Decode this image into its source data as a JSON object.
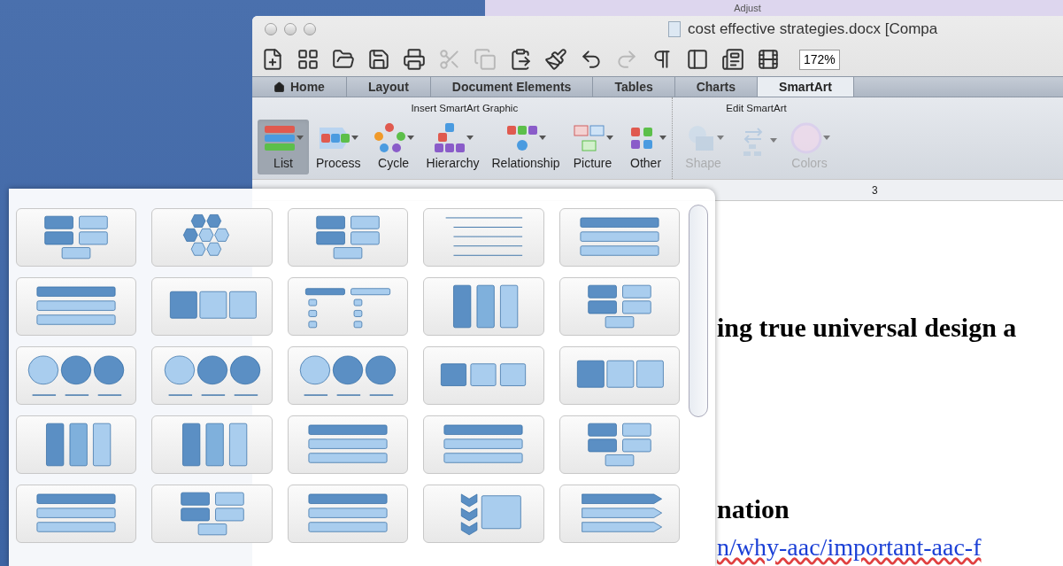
{
  "background_window": {
    "title": "Adjust"
  },
  "window": {
    "title": "cost effective strategies.docx [Compa"
  },
  "toolbar": {
    "zoom": "172%"
  },
  "tabs": [
    {
      "label": "Home",
      "kind": "home",
      "selected": false
    },
    {
      "label": "Layout",
      "kind": "plain",
      "selected": false
    },
    {
      "label": "Document Elements",
      "kind": "plain",
      "selected": false
    },
    {
      "label": "Tables",
      "kind": "plain",
      "selected": false
    },
    {
      "label": "Charts",
      "kind": "plain",
      "selected": false
    },
    {
      "label": "SmartArt",
      "kind": "plain",
      "selected": true
    }
  ],
  "ribbon": {
    "groups": [
      {
        "title": "Insert SmartArt Graphic",
        "buttons": [
          {
            "label": "List",
            "kind": "list",
            "selected": true,
            "disabled": false
          },
          {
            "label": "Process",
            "kind": "process",
            "selected": false,
            "disabled": false
          },
          {
            "label": "Cycle",
            "kind": "cycle",
            "selected": false,
            "disabled": false
          },
          {
            "label": "Hierarchy",
            "kind": "hierarchy",
            "selected": false,
            "disabled": false
          },
          {
            "label": "Relationship",
            "kind": "relationship",
            "selected": false,
            "disabled": false
          },
          {
            "label": "Picture",
            "kind": "picture",
            "selected": false,
            "disabled": false
          },
          {
            "label": "Other",
            "kind": "other",
            "selected": false,
            "disabled": false
          }
        ]
      },
      {
        "title": "Edit SmartArt",
        "buttons": [
          {
            "label": "Shape",
            "kind": "shape",
            "selected": false,
            "disabled": true
          },
          {
            "kind": "arrange",
            "selected": false,
            "disabled": true
          },
          {
            "label": "Colors",
            "kind": "colors",
            "selected": false,
            "disabled": true
          }
        ]
      }
    ]
  },
  "ruler": {
    "marker": "3"
  },
  "document": {
    "lines": [
      {
        "kind": "heading",
        "text": "ing true universal design a"
      },
      {
        "kind": "heading",
        "text": "nation"
      },
      {
        "kind": "link",
        "text": "n/why-aac/important-aac-f"
      }
    ]
  },
  "gallery": {
    "items": [
      {
        "kind": "blocks"
      },
      {
        "kind": "hexagons"
      },
      {
        "kind": "blocks"
      },
      {
        "kind": "lines"
      },
      {
        "kind": "bars"
      },
      {
        "kind": "bars"
      },
      {
        "kind": "tables"
      },
      {
        "kind": "tree"
      },
      {
        "kind": "columns"
      },
      {
        "kind": "blocks"
      },
      {
        "kind": "circles"
      },
      {
        "kind": "circles"
      },
      {
        "kind": "circles"
      },
      {
        "kind": "process"
      },
      {
        "kind": "tables"
      },
      {
        "kind": "columns"
      },
      {
        "kind": "columns"
      },
      {
        "kind": "bars"
      },
      {
        "kind": "bars"
      },
      {
        "kind": "blocks"
      },
      {
        "kind": "bars"
      },
      {
        "kind": "blocks"
      },
      {
        "kind": "bars"
      },
      {
        "kind": "chevrons"
      },
      {
        "kind": "arrows"
      }
    ]
  }
}
